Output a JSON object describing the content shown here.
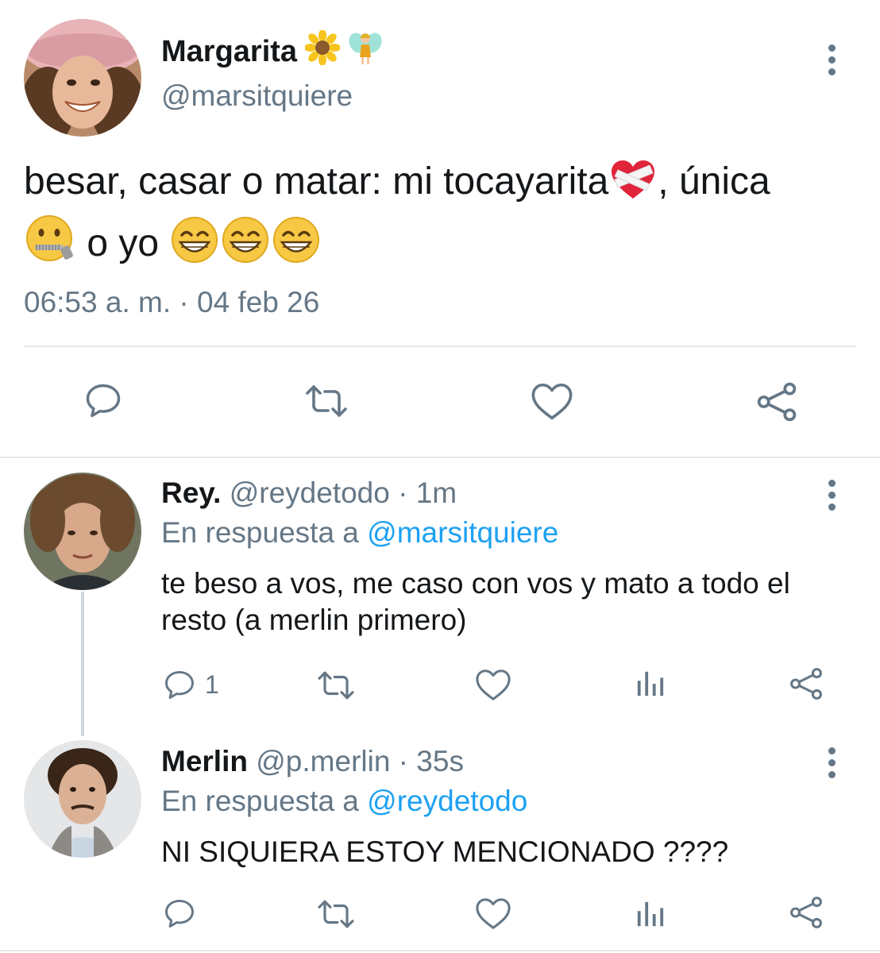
{
  "main_tweet": {
    "author_name": "Margarita",
    "author_handle": "@marsitquiere",
    "name_emojis": [
      "sunflower-icon",
      "fairy-icon"
    ],
    "text_line1": "besar, casar o matar: mi tocayarita",
    "text_line1_end": ", única",
    "text_line2": "o yo",
    "timestamp": "06:53 a. m. · 04 feb 26"
  },
  "replies": [
    {
      "name": "Rey.",
      "handle_time": "@reydetodo · 1m",
      "reply_prefix": "En respuesta a",
      "reply_to": "@marsitquiere",
      "text": "te beso a vos, me caso con vos y mato a todo el resto (a merlin primero)",
      "reply_count": "1"
    },
    {
      "name": "Merlin",
      "handle_time": "@p.merlin · 35s",
      "reply_prefix": "En respuesta a",
      "reply_to": "@reydetodo",
      "text": "NI SIQUIERA ESTOY MENCIONADO ????",
      "reply_count": ""
    }
  ],
  "colors": {
    "text": "#14171a",
    "secondary": "#657786",
    "link": "#1da1f2",
    "divider": "#e1e8ed"
  }
}
